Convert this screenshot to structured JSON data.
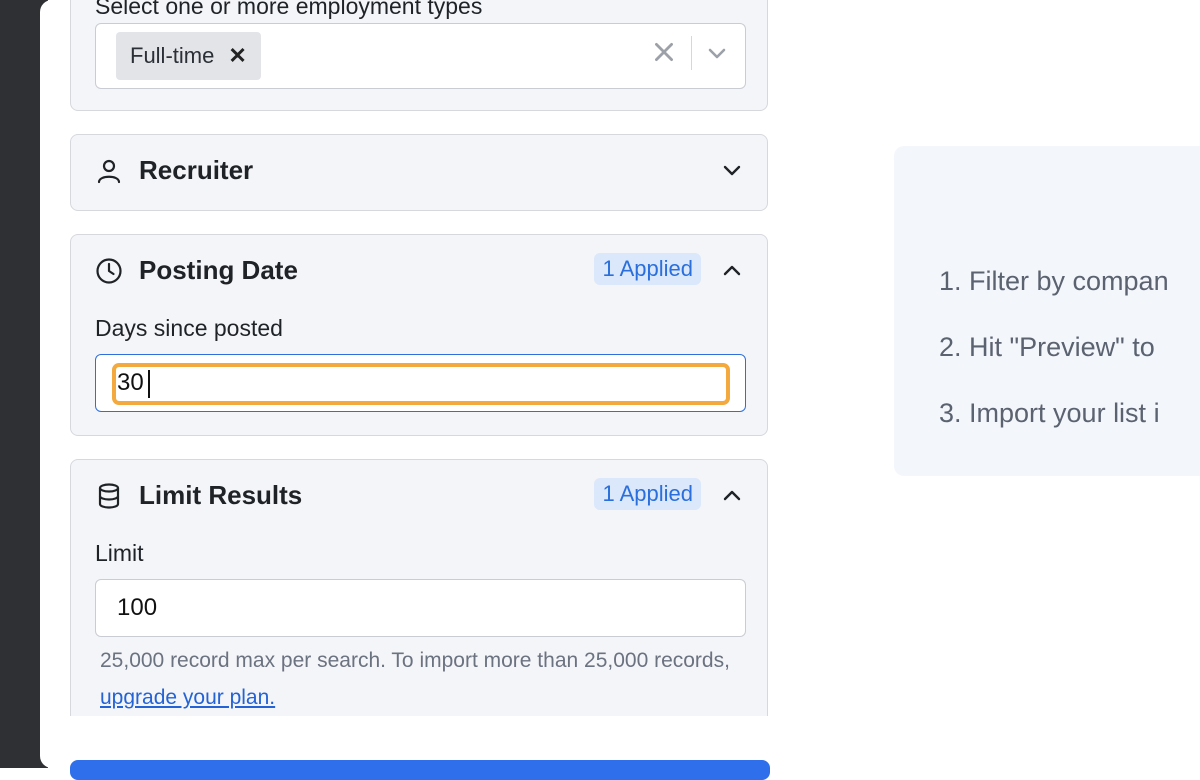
{
  "employment": {
    "label_partial": "Select one or more employment types",
    "selected_chip": "Full-time"
  },
  "recruiter": {
    "title": "Recruiter"
  },
  "posting_date": {
    "title": "Posting Date",
    "badge": "1 Applied",
    "field_label": "Days since posted",
    "value": "30"
  },
  "limit_results": {
    "title": "Limit Results",
    "badge": "1 Applied",
    "field_label": "Limit",
    "value": "100",
    "help_text": "25,000 record max per search. To import more than 25,000 records,",
    "help_link": "upgrade your plan."
  },
  "steps": [
    "1. Filter by compan",
    "2. Hit \"Preview\" to",
    "3. Import your list i"
  ],
  "colors": {
    "accent": "#2f6fdd",
    "focus_ring": "#f3a93d",
    "badge_bg": "#dbe8fb"
  }
}
